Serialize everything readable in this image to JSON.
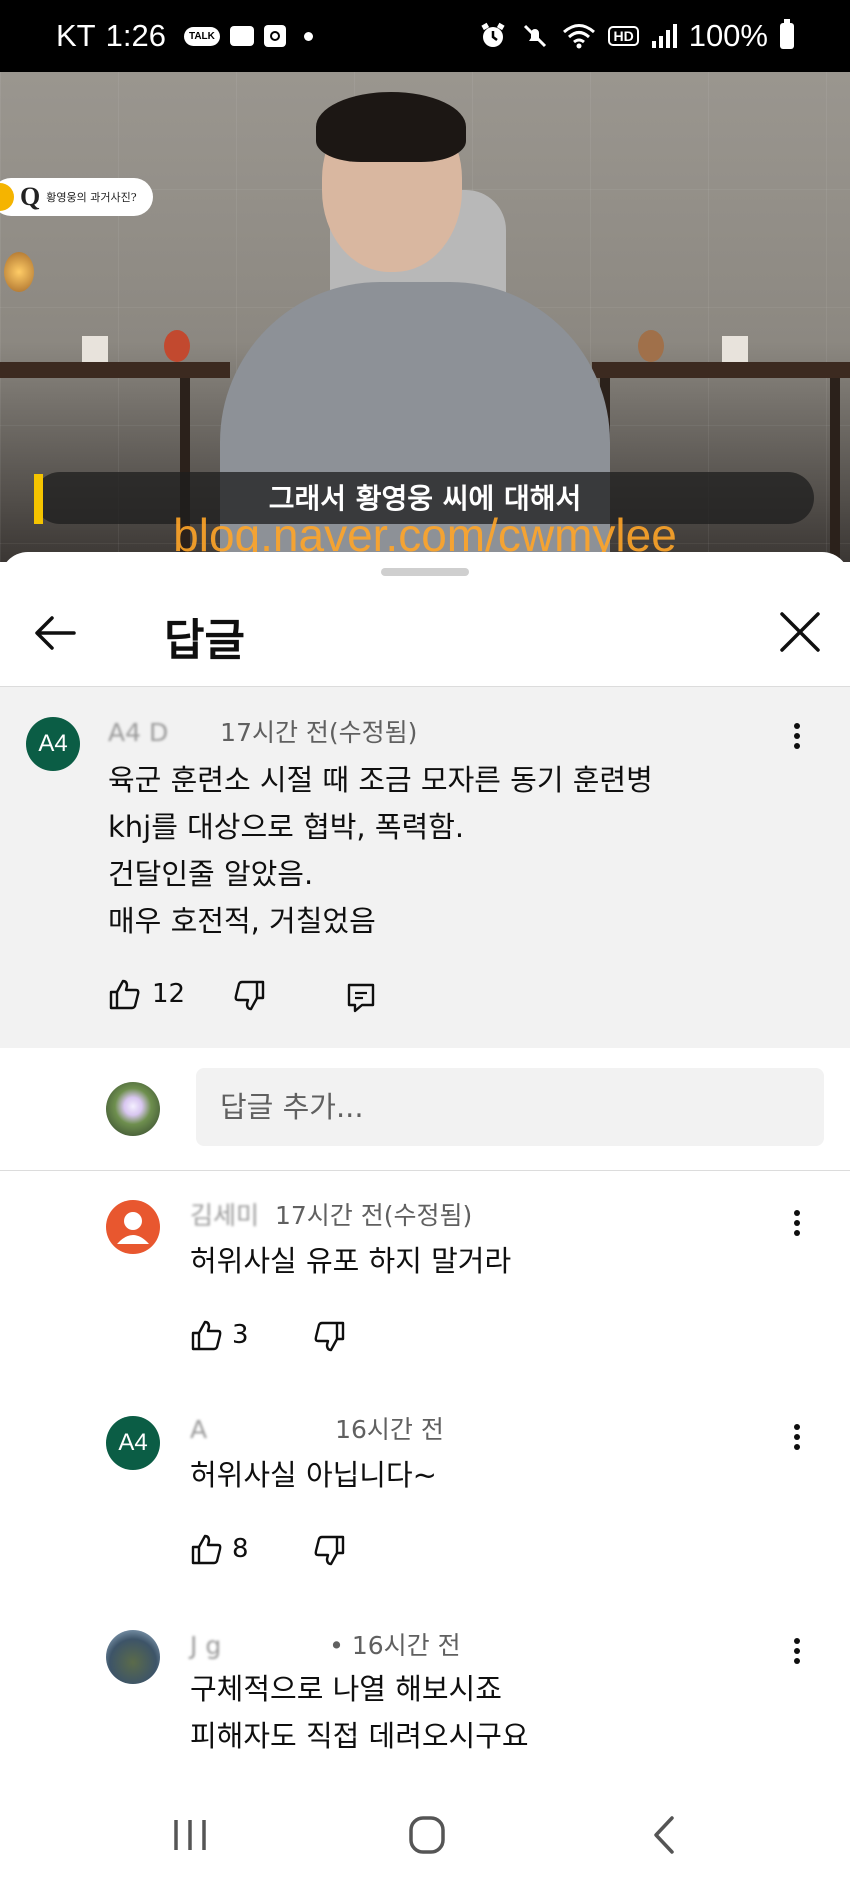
{
  "status_bar": {
    "carrier": "KT",
    "time": "1:26",
    "talk_icon_text": "TALK",
    "hd_label": "HD",
    "battery": "100%"
  },
  "video": {
    "question_badge": "Q",
    "question_text": "황영웅의 과거사진?",
    "subtitle": "그래서 황영웅 씨에 대해서",
    "watermark": "blog.naver.com/cwmylee"
  },
  "sheet": {
    "title": "답글"
  },
  "parent_comment": {
    "avatar_text": "A4",
    "avatar_color": "#0b5d45",
    "author": "A4 D",
    "time": "17시간 전(수정됨)",
    "lines": [
      "육군 훈련소 시절 때 조금 모자른 동기 훈련병",
      "khj를 대상으로 협박, 폭력함.",
      "건달인줄 알았음.",
      "매우 호전적, 거칠었음"
    ],
    "likes": "12"
  },
  "reply_input": {
    "placeholder": "답글 추가..."
  },
  "replies": [
    {
      "author": "김세미",
      "time": "17시간 전(수정됨)",
      "lines": [
        "허위사실 유포 하지 말거라"
      ],
      "likes": "3",
      "avatar_color": "#e8572f"
    },
    {
      "author": "A",
      "avatar_text": "A4",
      "time": "16시간 전",
      "lines": [
        "허위사실 아닙니다~"
      ],
      "likes": "8",
      "avatar_color": "#0b5d45"
    },
    {
      "author": "J g",
      "time": "• 16시간 전",
      "lines": [
        "구체적으로 나열 해보시죠",
        "피해자도 직접 데려오시구요"
      ],
      "avatar_color": "#4a6a86"
    }
  ]
}
